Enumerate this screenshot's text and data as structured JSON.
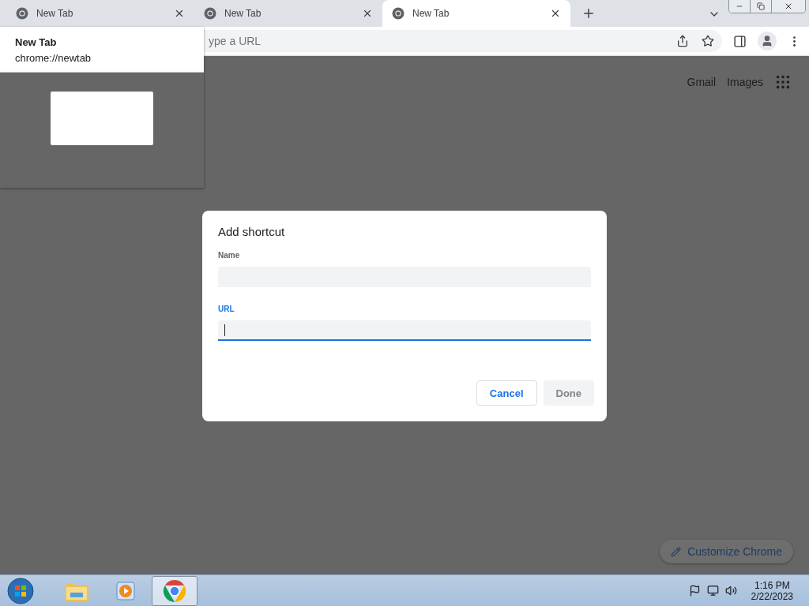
{
  "tabs": [
    {
      "title": "New Tab",
      "selected": false
    },
    {
      "title": "New Tab",
      "selected": false
    },
    {
      "title": "New Tab",
      "selected": true
    }
  ],
  "omnibox": {
    "placeholder": "ype a URL"
  },
  "hover_card": {
    "title": "New Tab",
    "url": "chrome://newtab"
  },
  "top_links": [
    "Gmail",
    "Images"
  ],
  "dialog": {
    "title": "Add shortcut",
    "fields": [
      {
        "label": "Name",
        "focused": false
      },
      {
        "label": "URL",
        "focused": true
      }
    ],
    "buttons": [
      {
        "label": "Cancel",
        "disabled": false
      },
      {
        "label": "Done",
        "disabled": true
      }
    ]
  },
  "customize_button": "Customize Chrome",
  "taskbar": {
    "apps": [
      {
        "kind": "explorer",
        "selected": false
      },
      {
        "kind": "media",
        "selected": false
      },
      {
        "kind": "chrome",
        "selected": true
      }
    ],
    "time": "1:16 PM",
    "date": "2/22/2023"
  }
}
